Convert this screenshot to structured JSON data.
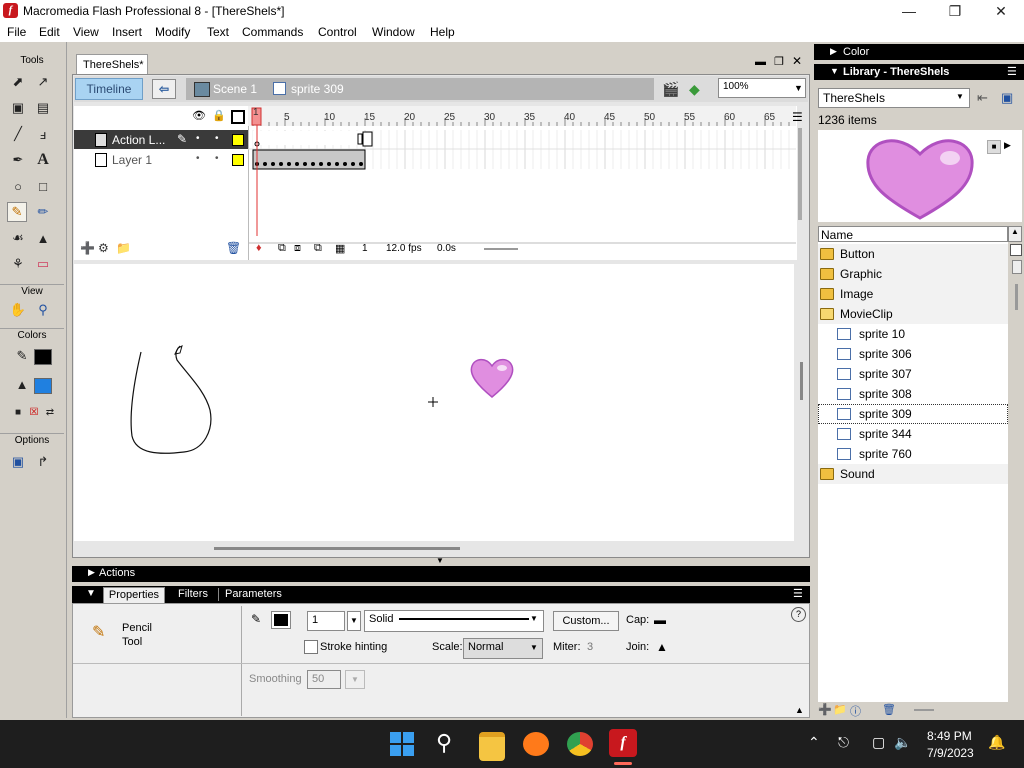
{
  "window": {
    "title": "Macromedia Flash Professional 8 - [ThereShels*]",
    "app_icon_letter": "f"
  },
  "menubar": [
    "File",
    "Edit",
    "View",
    "Insert",
    "Modify",
    "Text",
    "Commands",
    "Control",
    "Window",
    "Help"
  ],
  "tools": {
    "header": "Tools",
    "view_header": "View",
    "colors_header": "Colors",
    "options_header": "Options"
  },
  "document": {
    "tab": "ThereShels*",
    "timeline_button": "Timeline",
    "scene": "Scene 1",
    "symbol": "sprite 309",
    "zoom": "100%"
  },
  "timeline": {
    "layers": [
      {
        "name": "Action L...",
        "selected": true
      },
      {
        "name": "Layer 1",
        "selected": false
      }
    ],
    "ruler": [
      "1",
      "5",
      "10",
      "15",
      "20",
      "25",
      "30",
      "35",
      "40",
      "45",
      "50",
      "55",
      "60",
      "65"
    ],
    "current_frame": "1",
    "fps": "12.0 fps",
    "time": "0.0s"
  },
  "panels": {
    "actions": "Actions",
    "properties_tabs": [
      "Properties",
      "Filters",
      "Parameters"
    ]
  },
  "properties": {
    "tool_name": "Pencil",
    "tool_label": "Tool",
    "stroke_width": "1",
    "stroke_style": "Solid",
    "custom_button": "Custom...",
    "cap_label": "Cap:",
    "stroke_hinting": "Stroke hinting",
    "scale_label": "Scale:",
    "scale_value": "Normal",
    "miter_label": "Miter:",
    "miter_value": "3",
    "join_label": "Join:",
    "smoothing_label": "Smoothing",
    "smoothing_value": "50"
  },
  "right": {
    "color_panel": "Color",
    "library_panel": "Library - ThereShels",
    "library_select": "ThereSheIs",
    "items_count": "1236 items",
    "name_header": "Name",
    "items": [
      {
        "name": "Button",
        "type": "folder"
      },
      {
        "name": "Graphic",
        "type": "folder"
      },
      {
        "name": "Image",
        "type": "folder"
      },
      {
        "name": "MovieClip",
        "type": "open-folder"
      },
      {
        "name": "sprite 10",
        "type": "symbol"
      },
      {
        "name": "sprite 306",
        "type": "symbol"
      },
      {
        "name": "sprite 307",
        "type": "symbol"
      },
      {
        "name": "sprite 308",
        "type": "symbol"
      },
      {
        "name": "sprite 309",
        "type": "symbol",
        "selected": true
      },
      {
        "name": "sprite 344",
        "type": "symbol"
      },
      {
        "name": "sprite 760",
        "type": "symbol"
      },
      {
        "name": "Sound",
        "type": "folder"
      }
    ]
  },
  "taskbar": {
    "time": "8:49 PM",
    "date": "7/9/2023"
  },
  "colors": {
    "accent_timeline": "#a9d3f2",
    "heart": "#e08ee0",
    "playhead": "#e03030",
    "folder": "#f0c040"
  }
}
